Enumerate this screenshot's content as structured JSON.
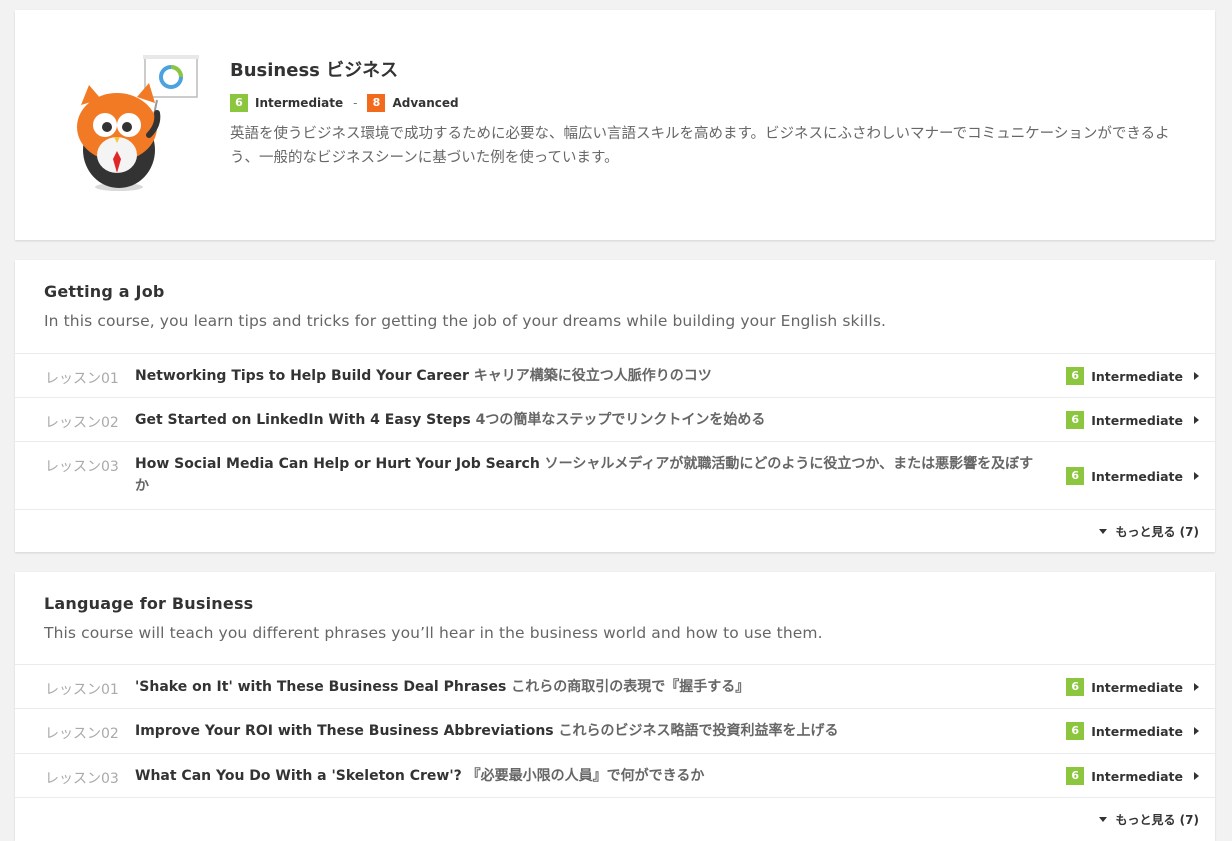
{
  "hero": {
    "title": "Business ビジネス",
    "level_from": {
      "number": "6",
      "label": "Intermediate",
      "color": "#8cc63f"
    },
    "separator": "-",
    "level_to": {
      "number": "8",
      "label": "Advanced",
      "color": "#f26b1d"
    },
    "description": "英語を使うビジネス環境で成功するために必要な、幅広い言語スキルを高めます。ビジネスにふさわしいマナーでコミュニケーションができるよう、一般的なビジネスシーンに基づいた例を使っています。",
    "mascot_icon": "owl-mascot-with-presentation-board-icon"
  },
  "courses": [
    {
      "title": "Getting a Job",
      "description": "In this course, you learn tips and tricks for getting the job of your dreams while building your English skills.",
      "lessons": [
        {
          "num": "レッスン01",
          "title_en": "Networking Tips to Help Build Your Career",
          "title_ja": "キャリア構築に役立つ人脈作りのコツ",
          "level_num": "6",
          "level_label": "Intermediate"
        },
        {
          "num": "レッスン02",
          "title_en": "Get Started on LinkedIn With 4 Easy Steps",
          "title_ja": "4つの簡単なステップでリンクトインを始める",
          "level_num": "6",
          "level_label": "Intermediate"
        },
        {
          "num": "レッスン03",
          "title_en": "How Social Media Can Help or Hurt Your Job Search",
          "title_ja": "ソーシャルメディアが就職活動にどのように役立つか、または悪影響を及ぼすか",
          "level_num": "6",
          "level_label": "Intermediate"
        }
      ],
      "more_label": "もっと見る (7)"
    },
    {
      "title": "Language for Business",
      "description": "This course will teach you different phrases you’ll hear in the business world and how to use them.",
      "lessons": [
        {
          "num": "レッスン01",
          "title_en": "'Shake on It' with These Business Deal Phrases",
          "title_ja": "これらの商取引の表現で『握手する』",
          "level_num": "6",
          "level_label": "Intermediate"
        },
        {
          "num": "レッスン02",
          "title_en": "Improve Your ROI with These Business Abbreviations",
          "title_ja": "これらのビジネス略語で投資利益率を上げる",
          "level_num": "6",
          "level_label": "Intermediate"
        },
        {
          "num": "レッスン03",
          "title_en": "What Can You Do With a 'Skeleton Crew'?",
          "title_ja": "『必要最小限の人員』で何ができるか",
          "level_num": "6",
          "level_label": "Intermediate"
        }
      ],
      "more_label": "もっと見る (7)"
    }
  ]
}
